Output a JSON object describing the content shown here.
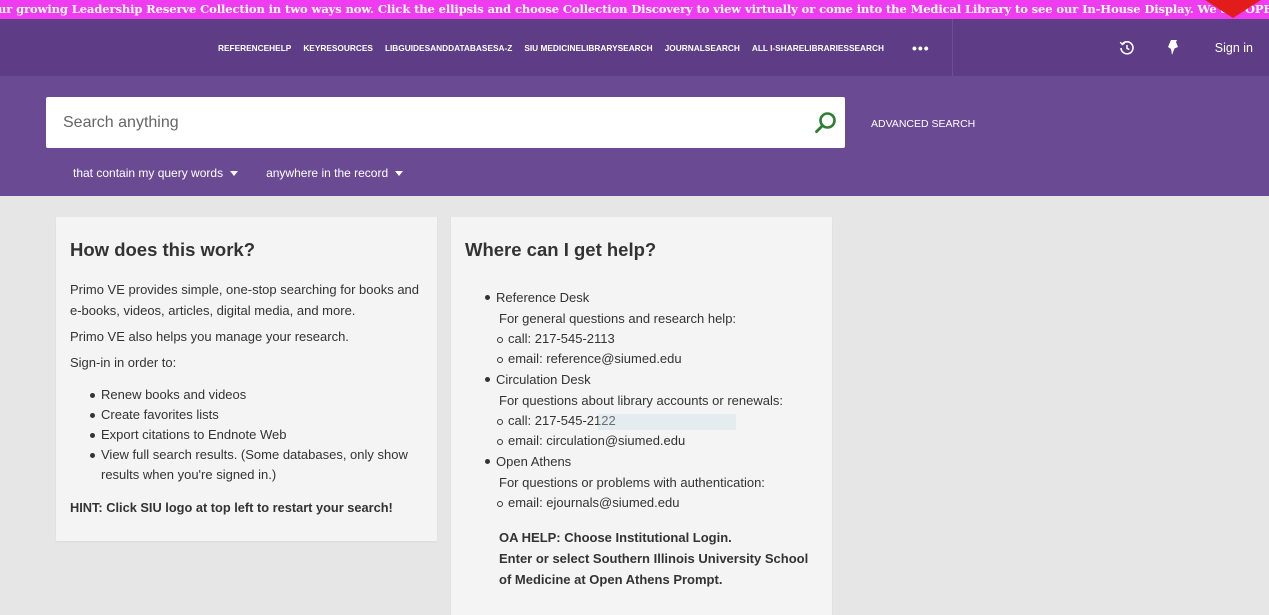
{
  "announcement": "ur growing Leadership Reserve Collection in two ways now. Click the ellipsis and choose Collection Discovery to view virtually or come into the Medical Library to see our In-House Display. We are OPEN!",
  "nav": {
    "items": [
      [
        "REFERENCE",
        "HELP"
      ],
      [
        "KEY",
        "RESOURCES"
      ],
      [
        "LIBGUIDES",
        "AND",
        "DATABASES",
        "A-Z"
      ],
      [
        "SIU MEDICINE",
        "LIBRARY",
        "SEARCH"
      ],
      [
        "JOURNAL",
        "SEARCH"
      ],
      [
        "ALL I-SHARE",
        "LIBRARIES",
        "SEARCH"
      ]
    ],
    "more": "•••",
    "sign_in": "Sign in",
    "history_icon": "history-icon",
    "pin_icon": "pin-icon"
  },
  "search": {
    "placeholder": "Search anything",
    "advanced": "ADVANCED SEARCH",
    "filter1": "that contain my query words",
    "filter2": "anywhere in the record"
  },
  "how": {
    "title": "How does this work?",
    "p1": "Primo VE provides simple, one-stop searching for books and e-books, videos, articles, digital media, and more.",
    "p2": "Primo VE also helps you manage your research.",
    "p3": "Sign-in in order to:",
    "items": [
      "Renew books and videos",
      "Create favorites lists",
      "Export citations to Endnote Web",
      "View full search results. (Some databases, only show results when you're signed in.)"
    ],
    "hint": "HINT: Click SIU logo at top left to restart your search!"
  },
  "help": {
    "title": "Where can I get help?",
    "entries": [
      {
        "name": "Reference Desk",
        "desc": "For general questions and research help:",
        "contacts": [
          "call: 217-545-2113",
          "email: reference@siumed.edu"
        ]
      },
      {
        "name": "Circulation Desk",
        "desc": "For questions about library accounts or renewals:",
        "contacts": [
          "call: 217-545-2122",
          "email: circulation@siumed.edu"
        ]
      },
      {
        "name": "Open Athens",
        "desc": "For questions or problems with authentication:",
        "contacts": [
          "email: ejournals@siumed.edu"
        ]
      }
    ],
    "oa_line1": "OA HELP: Choose Institutional Login.",
    "oa_line2": "Enter or select Southern Illinois University School of Medicine at Open Athens Prompt."
  },
  "colors": {
    "announcement_bg": "#f03cf0",
    "topbar_bg": "#5e3c86",
    "search_bg": "#6b4a94",
    "search_icon": "#2e7d32"
  }
}
